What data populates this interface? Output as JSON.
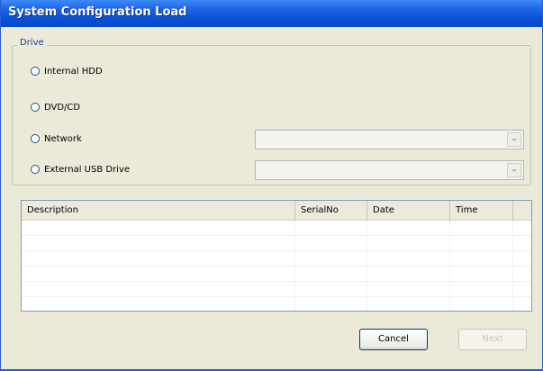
{
  "window": {
    "title": "System Configuration Load"
  },
  "drive_group": {
    "legend": "Drive",
    "options": [
      {
        "label": "Internal HDD",
        "selected": false
      },
      {
        "label": "DVD/CD",
        "selected": false
      },
      {
        "label": "Network",
        "selected": false
      },
      {
        "label": "External USB Drive",
        "selected": false
      }
    ],
    "network_select": {
      "value": "",
      "enabled": false
    },
    "usb_select": {
      "value": "",
      "enabled": false
    }
  },
  "table": {
    "columns": [
      "Description",
      "SerialNo",
      "Date",
      "Time"
    ],
    "rows": []
  },
  "buttons": {
    "cancel": "Cancel",
    "next": "Next",
    "next_enabled": false
  },
  "colors": {
    "title_bar": "#0a4fd8",
    "dialog_background": "#ece9d8",
    "legend_text": "#1c3a9e",
    "disabled_text": "#c9c7ba"
  }
}
